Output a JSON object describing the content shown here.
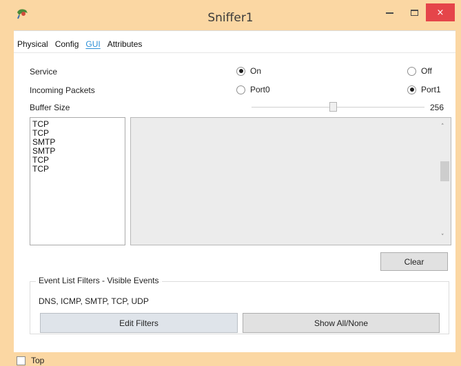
{
  "window": {
    "title": "Sniffer1",
    "icons": {
      "app": "packet-tracer-icon",
      "minimize": "minimize-icon",
      "maximize": "maximize-icon",
      "close": "close-icon"
    },
    "close_glyph": "×"
  },
  "tabs": [
    {
      "label": "Physical",
      "active": false
    },
    {
      "label": "Config",
      "active": false
    },
    {
      "label": "GUI",
      "active": true
    },
    {
      "label": "Attributes",
      "active": false
    }
  ],
  "service": {
    "label": "Service",
    "options": [
      {
        "label": "On",
        "selected": true
      },
      {
        "label": "Off",
        "selected": false
      }
    ]
  },
  "incoming_packets": {
    "label": "Incoming Packets",
    "options": [
      {
        "label": "Port0",
        "selected": false
      },
      {
        "label": "Port1",
        "selected": true
      }
    ]
  },
  "buffer_size": {
    "label": "Buffer Size",
    "value": "256"
  },
  "packet_list": [
    "TCP",
    "TCP",
    "SMTP",
    "SMTP",
    "TCP",
    "TCP"
  ],
  "detail_scroll": {
    "up_glyph": "˄",
    "down_glyph": "˅"
  },
  "buttons": {
    "clear": "Clear"
  },
  "event_filters": {
    "title": "Event List Filters - Visible Events",
    "events": "DNS, ICMP, SMTP, TCP, UDP",
    "edit_label": "Edit Filters",
    "show_all_label": "Show All/None"
  },
  "top_checkbox": {
    "label": "Top",
    "checked": false
  },
  "colors": {
    "frame": "#fbd7a3",
    "close": "#e5454a",
    "active_tab": "#2a8ed6"
  }
}
